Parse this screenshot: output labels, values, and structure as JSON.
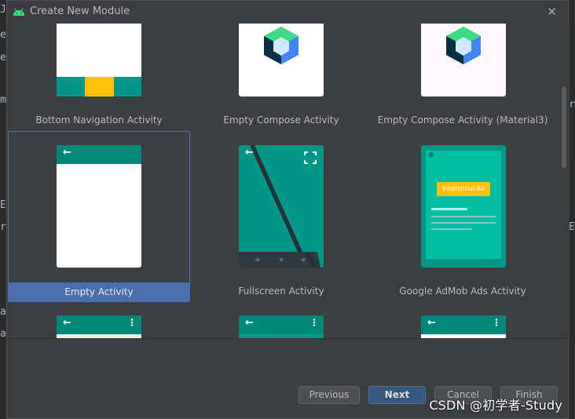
{
  "dialog": {
    "title": "Create New Module",
    "close_label": "✕"
  },
  "background": {
    "left_chars": [
      "J",
      "e",
      "e",
      "m",
      "E",
      "r",
      "a",
      "a"
    ],
    "right_chars": [
      "r",
      "E"
    ]
  },
  "templates": [
    {
      "name": "Bottom Navigation Activity",
      "selected": false
    },
    {
      "name": "Empty Compose Activity",
      "selected": false
    },
    {
      "name": "Empty Compose Activity (Material3)",
      "selected": false
    },
    {
      "name": "Empty Activity",
      "selected": true
    },
    {
      "name": "Fullscreen Activity",
      "selected": false
    },
    {
      "name": "Google AdMob Ads Activity",
      "selected": false
    }
  ],
  "admob": {
    "ad_label": "Interstitial Ad"
  },
  "buttons": {
    "previous": "Previous",
    "next": "Next",
    "cancel": "Cancel",
    "finish": "Finish"
  },
  "watermark": "CSDN @初学者-Study",
  "colors": {
    "teal": "#009688",
    "selection": "#4b6eaf",
    "dialog_bg": "#3c3f41",
    "accent_yellow": "#ffc107"
  }
}
